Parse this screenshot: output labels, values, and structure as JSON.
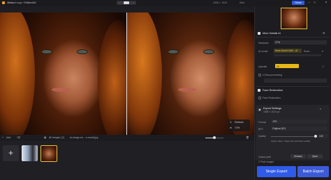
{
  "app": {
    "title": "Aiarty Image Enhancer"
  },
  "compare": {
    "before_label": "Before",
    "before_size": "768 × 512",
    "after_size": "1536 × 1024",
    "after_label": "After"
  },
  "overlay": {
    "refresh_label": "Refresh",
    "zoom": "72%"
  },
  "toolbar": {
    "add_label": "Add",
    "all_images": "All images (2)",
    "current_file": "ai-image-en... e-small.jpg"
  },
  "topnav": {
    "home_label": "Home"
  },
  "panel": {
    "more_details": "More Details AI",
    "hardware_label": "Hardware",
    "hardware_value": "CPU",
    "ai_model_label": "AI model",
    "ai_model_value": "More-Detail GAN - v2",
    "ai_model_sub": "Reali...",
    "upscale_label": "Upscale",
    "upscale_value": "2X",
    "prepass_label": "2-Pass processing",
    "face_section": "Face Restoration",
    "face_restoration_label": "Face Restoration",
    "export_section": "Export Settings",
    "export_info": "1536 × 1024 px",
    "format_label": "Format",
    "format_value": "JPG",
    "bpc_label": "BPC",
    "bpc_value": "Original (8Y)",
    "quality_label": "Quality",
    "quality_value": "100",
    "quality_hint": "Larger value = larger file and better quality",
    "output_label": "Output path",
    "browse_label": "Browse",
    "open_label": "Open",
    "ready_text": "2 Final images",
    "single_export": "Single Export",
    "batch_export": "Batch Export"
  },
  "colors": {
    "accent": "#2f5be8",
    "highlight": "#f0c040"
  }
}
